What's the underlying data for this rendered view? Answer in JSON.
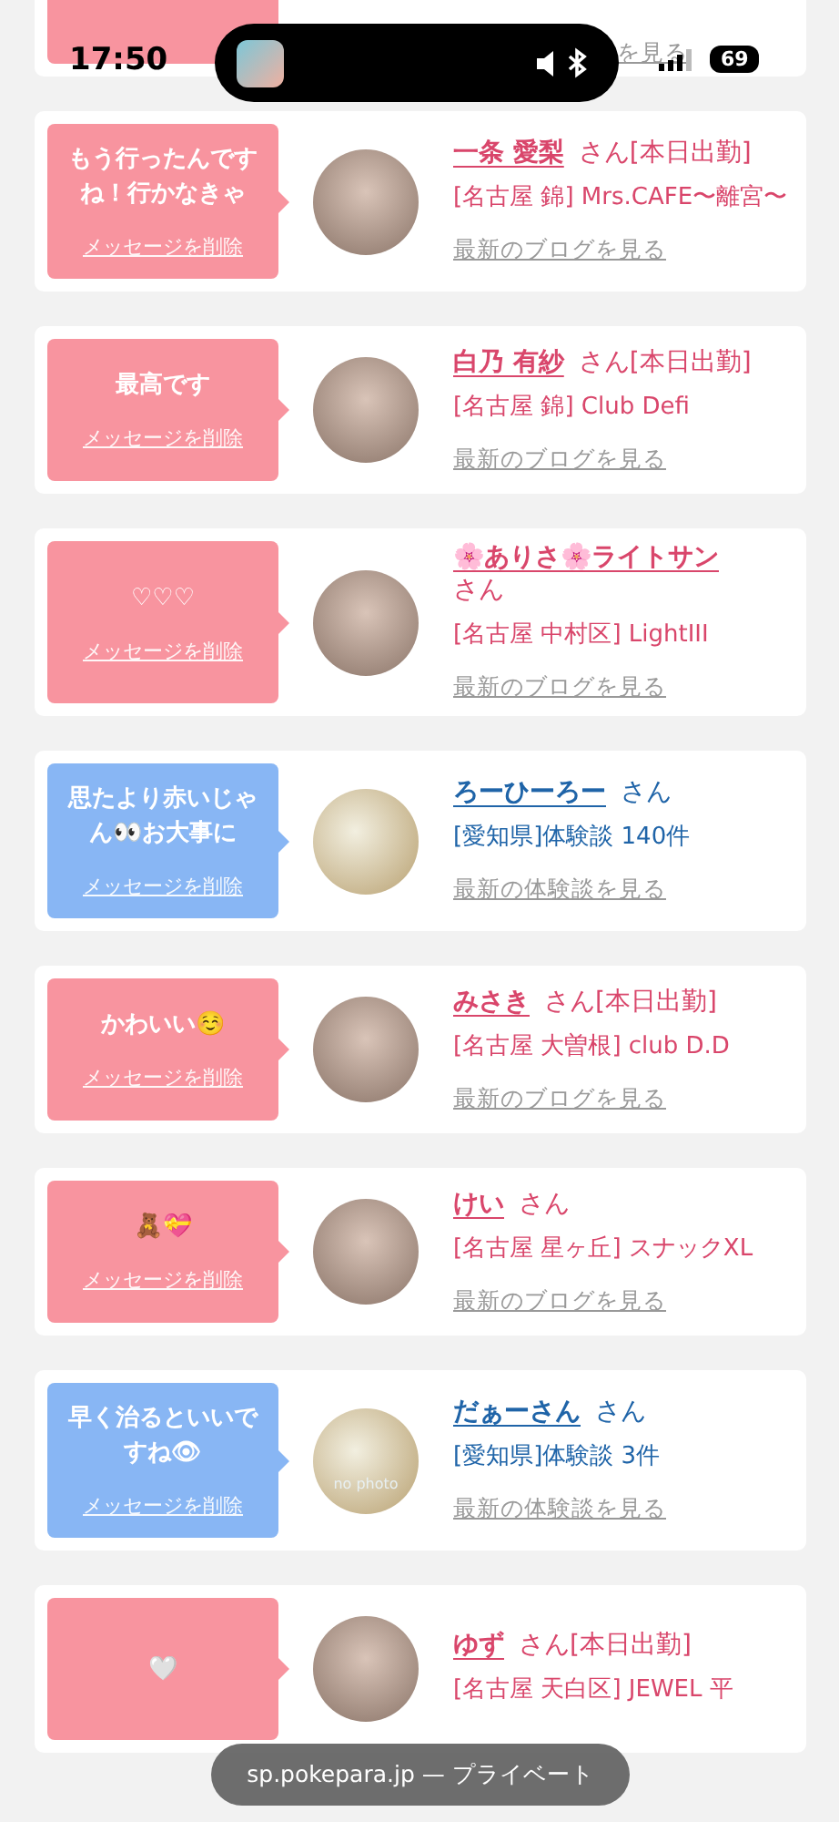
{
  "status_bar": {
    "time": "17:50",
    "battery": "69"
  },
  "cards": [
    {
      "kind": "cast",
      "link": "を見る"
    },
    {
      "kind": "cast",
      "message": "もう行ったんですね！行かなきゃ",
      "delete": "メッセージを削除",
      "name": "一条 愛梨",
      "san": "さん",
      "badge": "[本日出勤]",
      "shop": "[名古屋 錦] Mrs.CAFE〜離宮〜",
      "link": "最新のブログを見る"
    },
    {
      "kind": "cast",
      "message": "最高です",
      "delete": "メッセージを削除",
      "name": "白乃 有紗",
      "san": "さん",
      "badge": "[本日出勤]",
      "shop": "[名古屋 錦] Club Defi",
      "link": "最新のブログを見る"
    },
    {
      "kind": "cast",
      "message": "♡♡♡",
      "delete": "メッセージを削除",
      "name": "🌸ありさ🌸ライトサン",
      "san": "さん",
      "shop": "[名古屋 中村区] LightIII",
      "link": "最新のブログを見る",
      "wrap": true
    },
    {
      "kind": "user",
      "message": "思たより赤いじゃん👀お大事に",
      "delete": "メッセージを削除",
      "name": "ろーひーろー",
      "san": "さん",
      "shop": "[愛知県]体験談 140件",
      "link": "最新の体験談を見る"
    },
    {
      "kind": "cast",
      "message": "かわいい☺️",
      "delete": "メッセージを削除",
      "name": "みさき",
      "san": "さん",
      "badge": "[本日出勤]",
      "shop": "[名古屋 大曽根] club D.D",
      "link": "最新のブログを見る"
    },
    {
      "kind": "cast",
      "message": "🧸💝",
      "delete": "メッセージを削除",
      "name": "けい",
      "san": "さん",
      "shop": "[名古屋 星ヶ丘] スナックXL",
      "link": "最新のブログを見る"
    },
    {
      "kind": "user",
      "message": "早く治るといいですね👁",
      "delete": "メッセージを削除",
      "name": "だぁーさん",
      "san": "さん",
      "shop": "[愛知県]体験談 3件",
      "link": "最新の体験談を見る",
      "nophoto": "no photo"
    },
    {
      "kind": "cast",
      "message": "🤍",
      "name": "ゆず",
      "san": "さん",
      "badge": "[本日出勤]",
      "shop": "[名古屋 天白区] JEWEL 平"
    }
  ],
  "url_pill": "sp.pokepara.jp — プライベート"
}
